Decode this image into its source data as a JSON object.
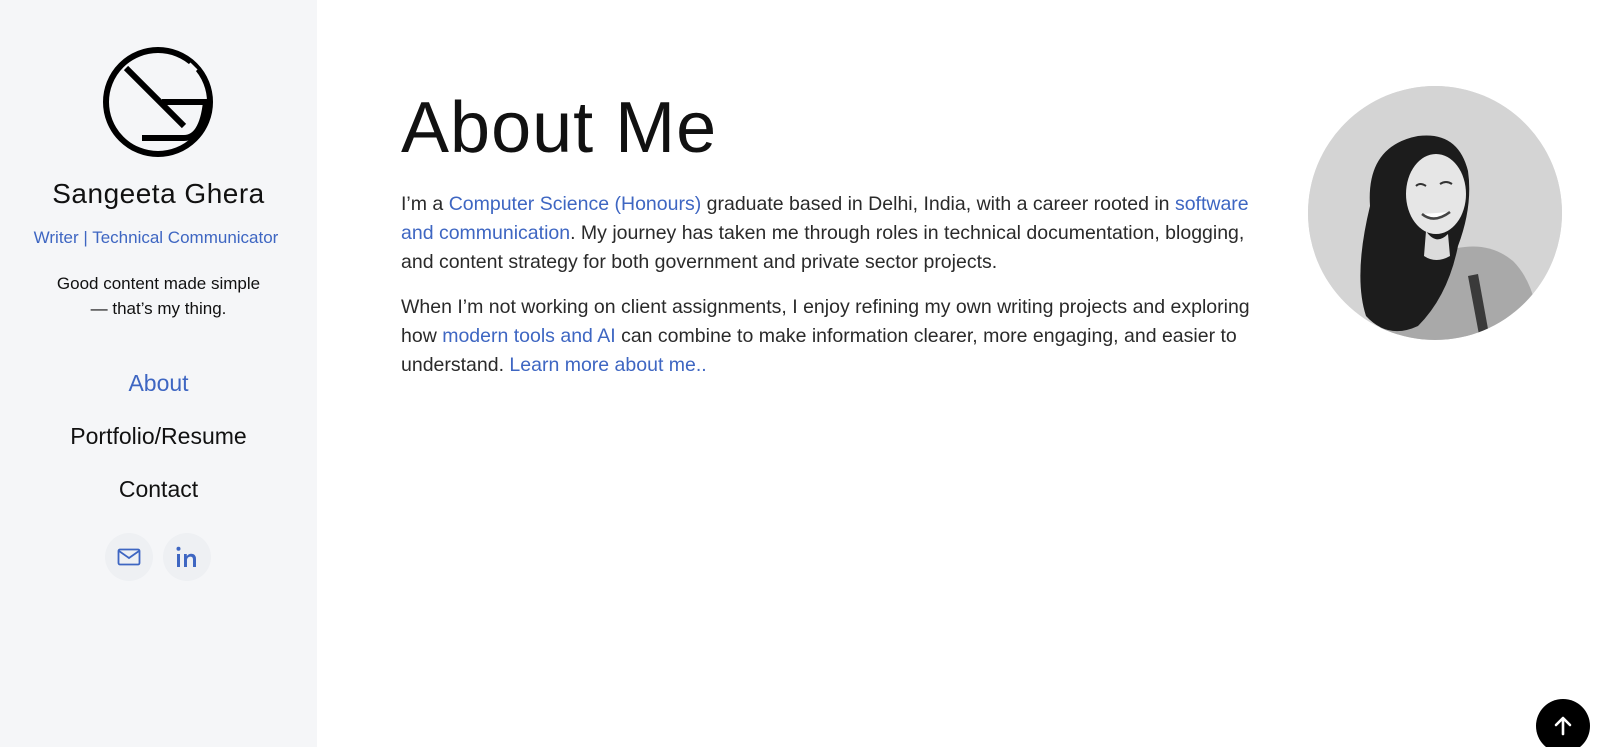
{
  "sidebar": {
    "name": "Sangeeta Ghera",
    "tagline": "Writer | Technical Communicator",
    "motto": "Good content made simple — that’s my thing.",
    "nav": [
      {
        "label": "About",
        "active": true
      },
      {
        "label": "Portfolio/Resume",
        "active": false
      },
      {
        "label": "Contact",
        "active": false
      }
    ],
    "social": [
      {
        "icon": "mail-icon"
      },
      {
        "icon": "linkedin-icon"
      }
    ],
    "accent_color": "#3e66c2"
  },
  "main": {
    "title": "About Me",
    "para1": {
      "t1": "I’m a ",
      "link1": "Computer Science (Honours)",
      "t2": " graduate based in Delhi, India, with a career rooted in ",
      "link2": "software and communication",
      "t3": ". My journey has taken me through roles in technical documentation, blogging, and content strategy for both government and private sector projects."
    },
    "para2": {
      "t1": "When I’m not working on client assignments, I enjoy refining my own writing projects and exploring how ",
      "link1": "modern tools and AI",
      "t2": " can combine to make information clearer, more engaging, and easier to understand. ",
      "link2": "Learn more about me.."
    }
  },
  "back_to_top": {
    "icon": "arrow-up-icon"
  }
}
